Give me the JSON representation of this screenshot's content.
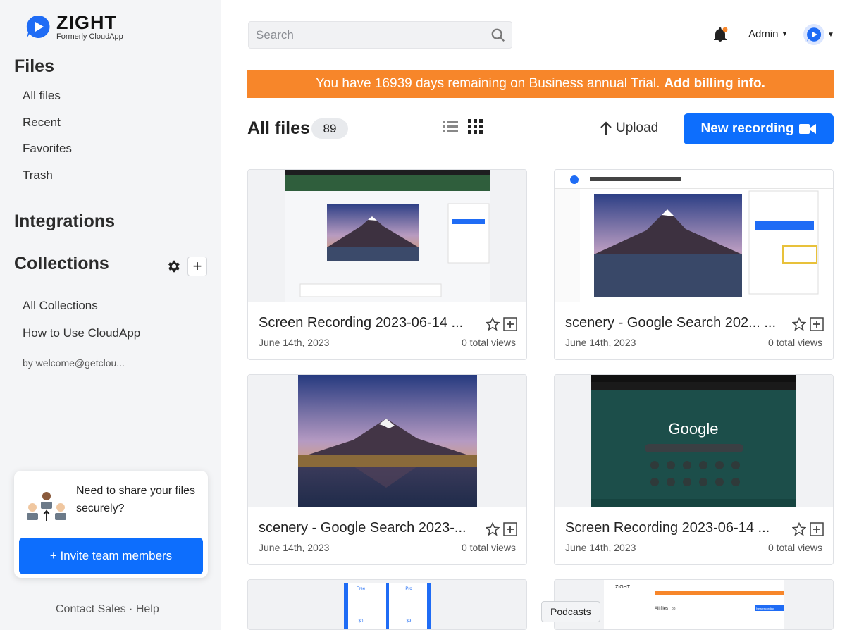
{
  "brand": {
    "name": "ZIGHT",
    "subtitle": "Formerly CloudApp",
    "color": "#1f6cf5"
  },
  "sidebar": {
    "files_heading": "Files",
    "files_items": [
      {
        "label": "All files"
      },
      {
        "label": "Recent"
      },
      {
        "label": "Favorites"
      },
      {
        "label": "Trash"
      }
    ],
    "integrations_heading": "Integrations",
    "collections_heading": "Collections",
    "collections_items": [
      {
        "label": "All Collections"
      },
      {
        "label": "How to Use CloudApp",
        "owner": "by welcome@getclou..."
      }
    ],
    "invite": {
      "text": "Need to share your files securely?",
      "button": "+ Invite team members"
    },
    "footer": "Contact Sales · Help"
  },
  "topbar": {
    "search_placeholder": "Search",
    "user_label": "Admin"
  },
  "banner": {
    "text": "You have 16939 days remaining on Business annual Trial.",
    "link": "Add billing info.",
    "color": "#f7862a"
  },
  "toolbar": {
    "title": "All files",
    "count": "89",
    "upload_label": "Upload",
    "new_recording_label": "New recording",
    "accent": "#0d6efd"
  },
  "files": [
    {
      "title": "Screen Recording 2023-06-14 ...",
      "date": "June 14th, 2023",
      "views": "0 total views",
      "thumb": "screen-recording-share-dialog"
    },
    {
      "title": "scenery - Google Search 202... ...",
      "date": "June 14th, 2023",
      "views": "0 total views",
      "thumb": "share-dialog-closeup"
    },
    {
      "title": "scenery - Google Search 2023-...",
      "date": "June 14th, 2023",
      "views": "0 total views",
      "thumb": "mountain-lake"
    },
    {
      "title": "Screen Recording 2023-06-14 ...",
      "date": "June 14th, 2023",
      "views": "0 total views",
      "thumb": "google-new-tab"
    }
  ],
  "partial_thumbs": {
    "left": {
      "plan_a": "Free",
      "plan_b": "Pro",
      "price_a": "$0",
      "price_b": "$9"
    },
    "right": {
      "mini_title": "All files",
      "mini_count": "83",
      "mini_button": "New recording",
      "mini_brand": "ZIGHT"
    }
  },
  "tooltip": "Podcasts"
}
